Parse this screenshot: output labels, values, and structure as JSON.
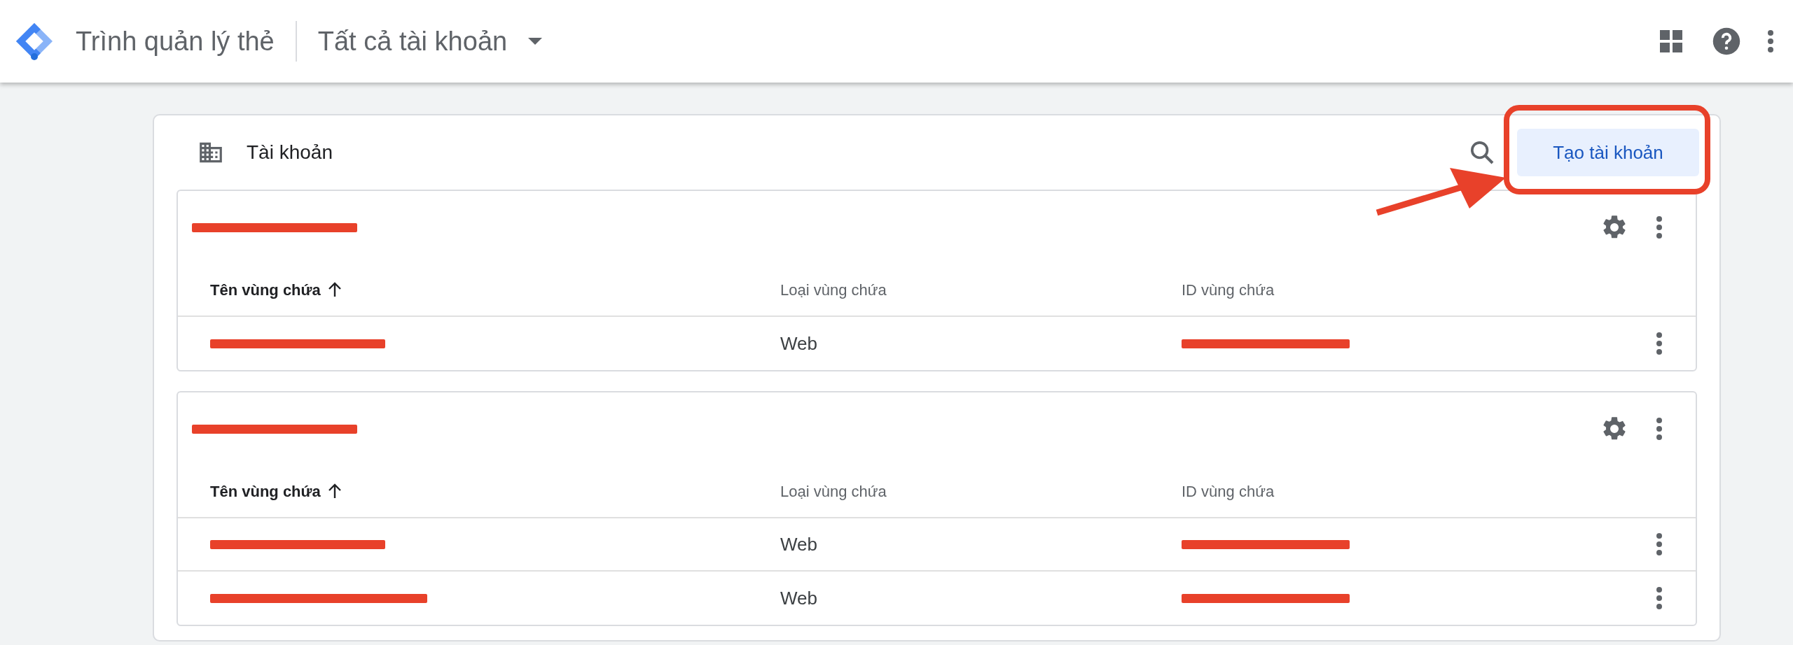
{
  "app_bar": {
    "product": "Trình quản lý thẻ",
    "account_switcher": "Tất cả tài khoản"
  },
  "panel": {
    "title": "Tài khoản",
    "create_button": "Tạo tài khoản"
  },
  "accounts": [
    {
      "name": {
        "kind": "redacted"
      },
      "columns": [
        "Tên vùng chứa",
        "Loại vùng chứa",
        "ID vùng chứa"
      ],
      "rows": [
        {
          "name": {
            "kind": "redacted"
          },
          "type": "Web",
          "id": {
            "kind": "redacted"
          }
        }
      ]
    },
    {
      "name": {
        "kind": "redacted"
      },
      "columns": [
        "Tên vùng chứa",
        "Loại vùng chứa",
        "ID vùng chứa"
      ],
      "rows": [
        {
          "name": {
            "kind": "redacted"
          },
          "type": "Web",
          "id": {
            "kind": "redacted"
          }
        },
        {
          "name": {
            "kind": "redacted"
          },
          "type": "Web",
          "id": {
            "kind": "redacted"
          }
        }
      ]
    }
  ]
}
